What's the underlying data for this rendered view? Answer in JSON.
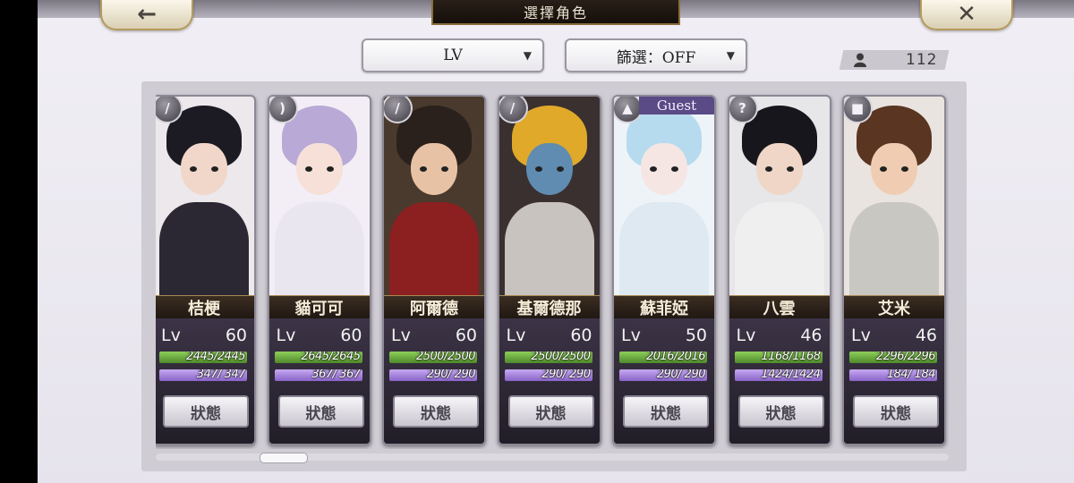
{
  "header": {
    "title": "選擇角色",
    "back_icon": "←",
    "close_icon": "✕"
  },
  "controls": {
    "sort_label": "LV",
    "filter_label": "篩選：OFF",
    "dropdown_arrow": "▼",
    "unit_count": "112"
  },
  "characters": [
    {
      "name": "桔梗",
      "lv_label": "Lv",
      "level": "60",
      "hp": "2445/2445",
      "mp": "347/ 347",
      "hp_ratio": 1,
      "mp_ratio": 1,
      "weapon": "sword-icon",
      "weapon_glyph": "/",
      "guest": false,
      "status": "狀態",
      "palette": {
        "hair": "#1c1a22",
        "skin": "#f1d7c9",
        "body": "#2b2833",
        "bg": "#ece8ec"
      }
    },
    {
      "name": "貓可可",
      "lv_label": "Lv",
      "level": "60",
      "hp": "2645/2645",
      "mp": "367/ 367",
      "hp_ratio": 1,
      "mp_ratio": 1,
      "weapon": "bow-icon",
      "weapon_glyph": ")",
      "guest": false,
      "status": "狀態",
      "palette": {
        "hair": "#b9a9d6",
        "skin": "#f6e0d8",
        "body": "#e9e6ef",
        "bg": "#f3eef6"
      }
    },
    {
      "name": "阿爾德",
      "lv_label": "Lv",
      "level": "60",
      "hp": "2500/2500",
      "mp": "290/ 290",
      "hp_ratio": 1,
      "mp_ratio": 1,
      "weapon": "sword-icon",
      "weapon_glyph": "/",
      "guest": false,
      "status": "狀態",
      "palette": {
        "hair": "#2a211c",
        "skin": "#e8c2a4",
        "body": "#8c1f20",
        "bg": "#4a3a2e"
      }
    },
    {
      "name": "基爾德那",
      "lv_label": "Lv",
      "level": "60",
      "hp": "2500/2500",
      "mp": "290/ 290",
      "hp_ratio": 1,
      "mp_ratio": 1,
      "weapon": "sword-icon",
      "weapon_glyph": "/",
      "guest": false,
      "status": "狀態",
      "palette": {
        "hair": "#e0a92a",
        "skin": "#5f8cb0",
        "body": "#c8c3bf",
        "bg": "#3a3030"
      }
    },
    {
      "name": "蘇菲婭",
      "lv_label": "Lv",
      "level": "50",
      "hp": "2016/2016",
      "mp": "290/ 290",
      "hp_ratio": 1,
      "mp_ratio": 1,
      "weapon": "axe-icon",
      "weapon_glyph": "▲",
      "guest": true,
      "guest_label": "Guest",
      "status": "狀態",
      "palette": {
        "hair": "#b6dbef",
        "skin": "#f6e6e3",
        "body": "#dfe9f2",
        "bg": "#eef3f8"
      }
    },
    {
      "name": "八雲",
      "lv_label": "Lv",
      "level": "46",
      "hp": "1168/1168",
      "mp": "1424/1424",
      "hp_ratio": 1,
      "mp_ratio": 1,
      "weapon": "hook-icon",
      "weapon_glyph": "?",
      "guest": false,
      "status": "狀態",
      "palette": {
        "hair": "#17161c",
        "skin": "#efd6c6",
        "body": "#efefef",
        "bg": "#e7e6e9"
      }
    },
    {
      "name": "艾米",
      "lv_label": "Lv",
      "level": "46",
      "hp": "2296/2296",
      "mp": "184/ 184",
      "hp_ratio": 1,
      "mp_ratio": 1,
      "weapon": "gauntlet-icon",
      "weapon_glyph": "■",
      "guest": false,
      "status": "狀態",
      "palette": {
        "hair": "#5a3522",
        "skin": "#f0cdb2",
        "body": "#c9c7c2",
        "bg": "#e9e4df"
      }
    }
  ]
}
